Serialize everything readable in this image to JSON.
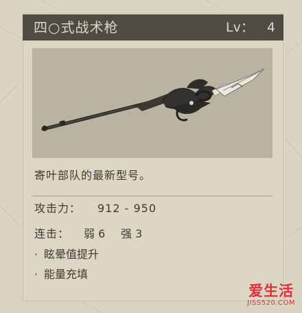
{
  "weapon": {
    "name": "四○式战术枪",
    "level_label": "Lv：",
    "level_value": "4",
    "description": "寄叶部队的最新型号。",
    "attack_label": "攻击力：",
    "attack_value": "912 - 950",
    "combo_label": "连击：",
    "combo_weak": "弱 6",
    "combo_strong": "强 3",
    "abilities": [
      "眩晕值提升",
      "能量充填"
    ],
    "bullet": "·"
  },
  "watermark": {
    "main": "爱生活",
    "sub": "JISS520.COM"
  },
  "colors": {
    "background": "#d9d4c3",
    "title_bar": "#4f4b43",
    "title_text": "#dcd7c5",
    "image_frame": "#b9b3a2",
    "body_text": "#3f3b33",
    "watermark": "#e0303a"
  },
  "icons": {
    "weapon_image": "spear-icon"
  }
}
